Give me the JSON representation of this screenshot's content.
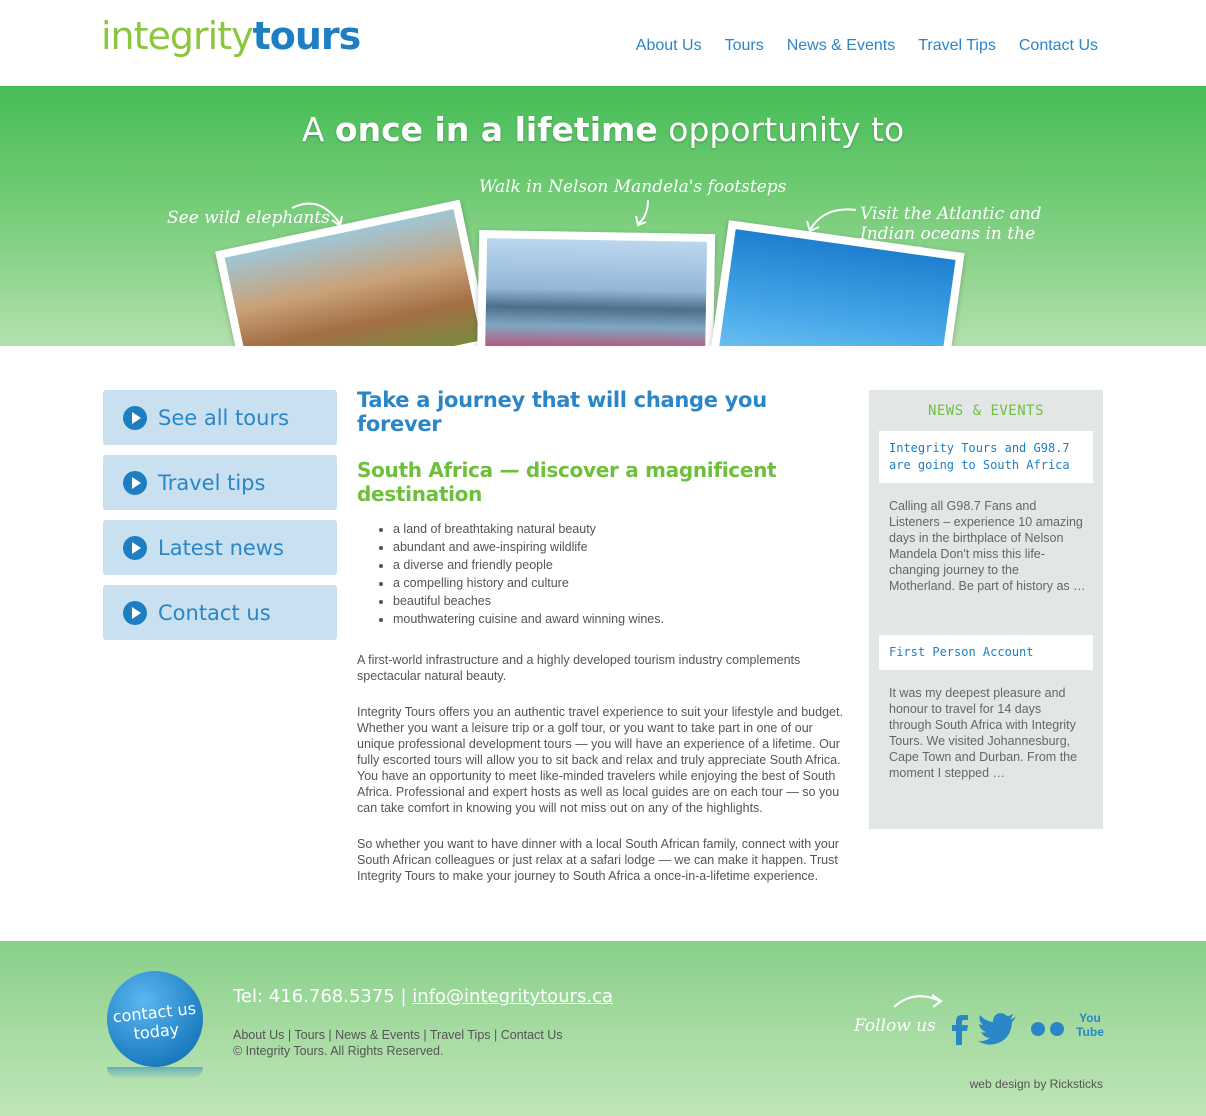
{
  "header": {
    "logo_part1": "integrity",
    "logo_part2": "tours",
    "nav": [
      "About Us",
      "Tours",
      "News & Events",
      "Travel Tips",
      "Contact Us"
    ]
  },
  "hero": {
    "title_pre": "A ",
    "title_bold": "once in a lifetime",
    "title_post": " opportunity to",
    "caption_left": "See wild elephants",
    "caption_center": "Walk in Nelson Mandela's footsteps",
    "caption_right": "Visit the Atlantic and Indian oceans in the same day"
  },
  "sidebar": {
    "items": [
      {
        "label": "See all tours",
        "icon": "play-icon"
      },
      {
        "label": "Travel tips",
        "icon": "play-icon"
      },
      {
        "label": "Latest news",
        "icon": "play-icon"
      },
      {
        "label": "Contact us",
        "icon": "play-icon"
      }
    ]
  },
  "main": {
    "heading": "Take a journey that will change you forever",
    "subheading": "South Africa — discover a magnificent destination",
    "bullets": [
      "a land of breathtaking natural beauty",
      "abundant and awe-inspiring wildlife",
      "a diverse and friendly people",
      "a compelling history and culture",
      "beautiful beaches",
      "mouthwatering cuisine and award winning wines."
    ],
    "paragraphs": [
      "A first-world infrastructure and a highly developed tourism industry complements spectacular natural beauty.",
      "Integrity Tours offers you an authentic travel experience to suit your lifestyle and budget. Whether you want a leisure trip or a golf tour, or you want to take part in one of our unique professional development tours — you will have an experience of a lifetime. Our fully escorted tours will allow you to sit back and relax and truly appreciate South Africa. You have an opportunity to meet like-minded travelers while enjoying the best of South Africa. Professional and expert hosts as well as local guides are on each tour — so you can take comfort in knowing you will not miss out on any of the highlights.",
      "So whether you want to have dinner with a local South African family, connect with your South African colleagues or just relax at a safari lodge — we can make it happen. Trust Integrity Tours to make your journey to South Africa a once-in-a-lifetime experience."
    ]
  },
  "news": {
    "heading": "NEWS & EVENTS",
    "items": [
      {
        "title": "Integrity Tours and G98.7 are going to South Africa",
        "body": "Calling all G98.7 Fans and Listeners – experience 10 amazing days in the birthplace of Nelson Mandela Don't miss this life-changing journey to the Motherland. Be part of history as …"
      },
      {
        "title": "First Person Account",
        "body": "It was my deepest pleasure and honour to travel for 14 days through South Africa with Integrity Tours. We visited Johannesburg, Cape Town and Durban. From the moment I stepped …"
      }
    ]
  },
  "footer": {
    "badge": "contact us today",
    "tel": "Tel: 416.768.5375 | ",
    "email": "info@integritytours.ca",
    "links": "About Us | Tours | News & Events | Travel Tips | Contact Us",
    "copyright": "© Integrity Tours. All Rights Reserved.",
    "follow": "Follow us",
    "social": [
      "facebook-icon",
      "twitter-icon",
      "flickr-icon",
      "youtube-icon"
    ],
    "youtube_label": "You Tube",
    "credit": "web design by Ricksticks"
  },
  "colors": {
    "brand_blue": "#1d7fc2",
    "brand_green": "#6fbf3c",
    "hero_green": "#46bd56",
    "sidebar_bg": "#c9e0f0",
    "news_bg": "#e3e6e7"
  }
}
